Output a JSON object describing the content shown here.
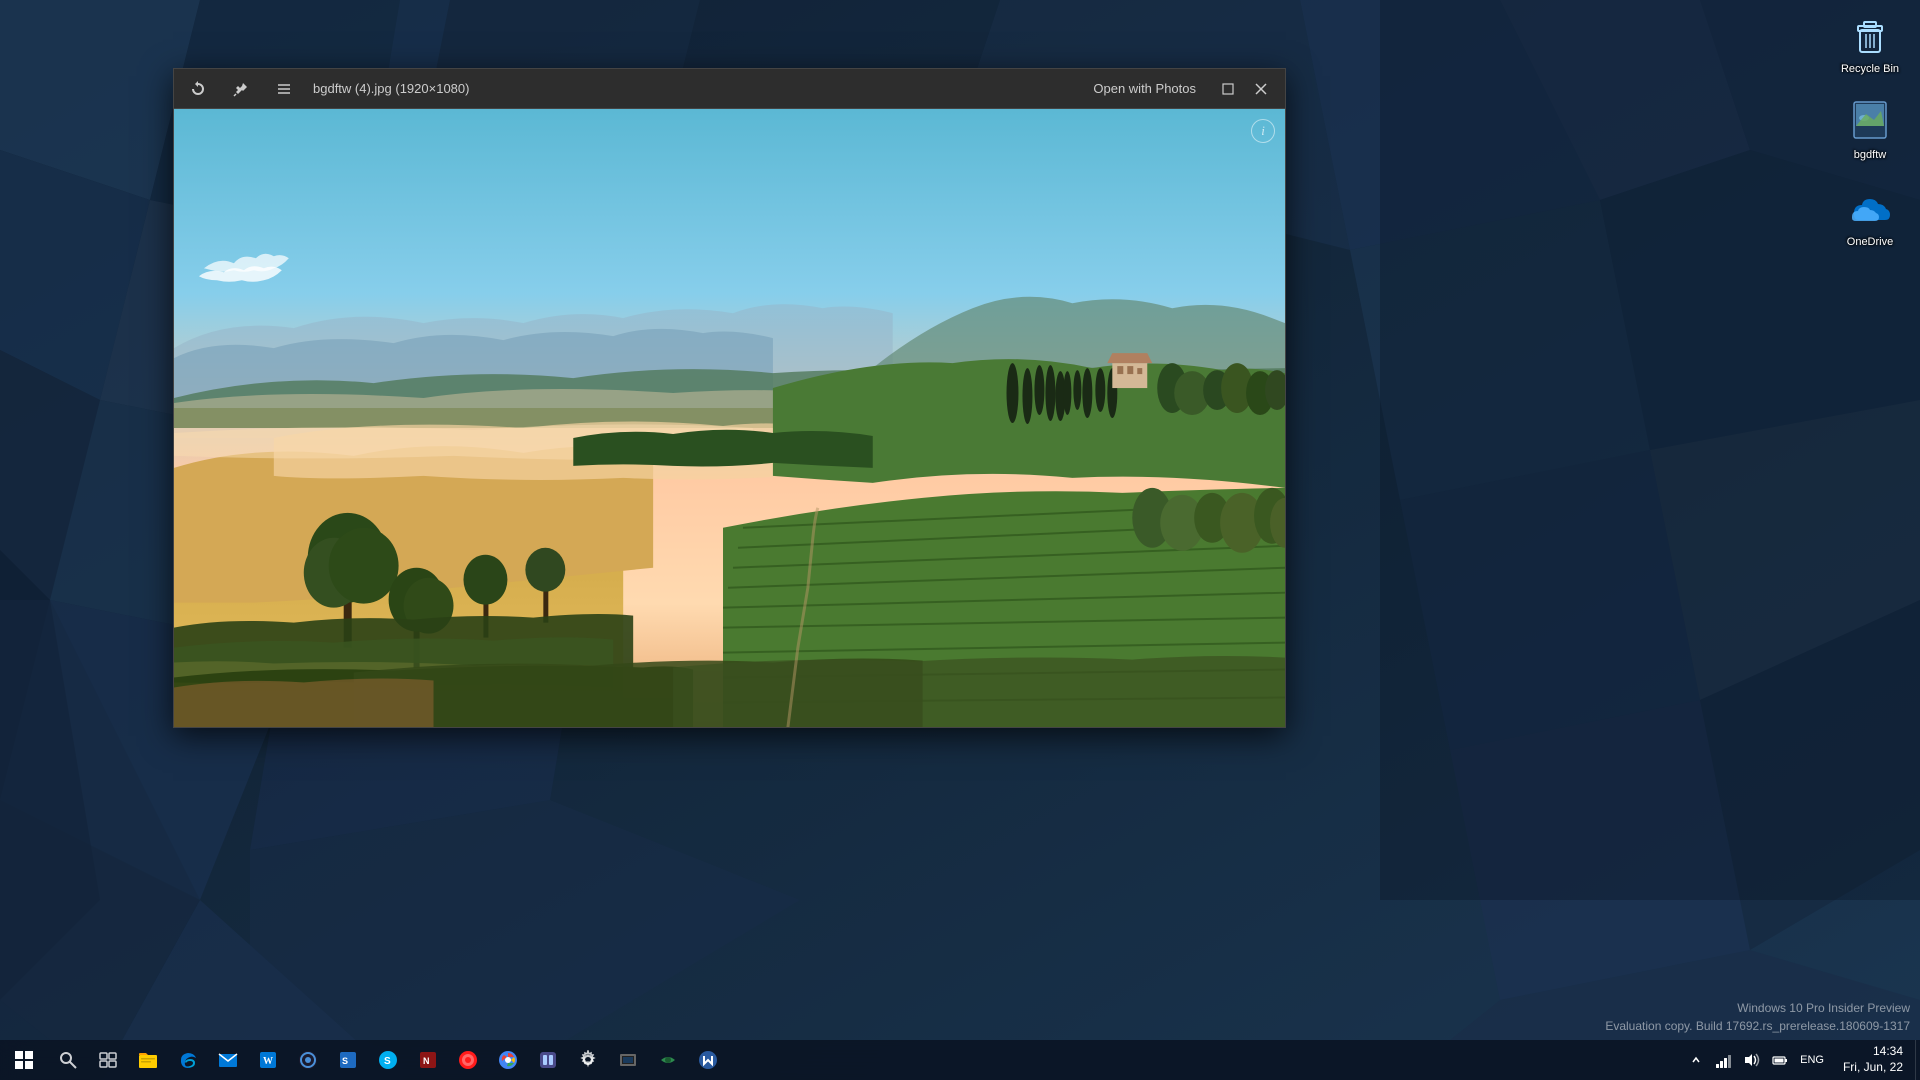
{
  "desktop": {
    "background_color": "#1e3048"
  },
  "desktop_icons": [
    {
      "id": "recycle-bin",
      "label": "Recycle Bin",
      "icon": "recycle-bin"
    },
    {
      "id": "bgdftw",
      "label": "bgdftw",
      "icon": "image-file"
    },
    {
      "id": "onedrive",
      "label": "OneDrive",
      "icon": "cloud"
    }
  ],
  "photo_viewer": {
    "title": "bgdftw (4).jpg (1920×1080)",
    "open_with_label": "Open with Photos",
    "toolbar": {
      "rotate_icon": "↑",
      "pin_icon": "📌",
      "menu_icon": "≡"
    },
    "info_icon": "i"
  },
  "taskbar": {
    "start_icon": "⊞",
    "search_icon": "🔍",
    "apps": [
      {
        "id": "start",
        "label": "Start",
        "icon": "⊞"
      },
      {
        "id": "search",
        "label": "Search",
        "icon": "⌕"
      },
      {
        "id": "taskview",
        "label": "Task View",
        "icon": "❑"
      },
      {
        "id": "explorer",
        "label": "File Explorer",
        "icon": "📁"
      },
      {
        "id": "edge",
        "label": "Microsoft Edge",
        "icon": "e"
      },
      {
        "id": "mail",
        "label": "Mail",
        "icon": "✉"
      },
      {
        "id": "folder",
        "label": "Folder",
        "icon": "📂"
      },
      {
        "id": "store",
        "label": "Store",
        "icon": "🛍"
      },
      {
        "id": "word",
        "label": "Word",
        "icon": "W"
      },
      {
        "id": "app1",
        "label": "App",
        "icon": "◎"
      },
      {
        "id": "app2",
        "label": "App2",
        "icon": "◈"
      },
      {
        "id": "skype",
        "label": "Skype",
        "icon": "S"
      },
      {
        "id": "app3",
        "label": "App3",
        "icon": "N"
      },
      {
        "id": "opera",
        "label": "Opera",
        "icon": "O"
      },
      {
        "id": "chrome",
        "label": "Chrome",
        "icon": "◉"
      },
      {
        "id": "app4",
        "label": "App4",
        "icon": "◇"
      },
      {
        "id": "settings",
        "label": "Settings",
        "icon": "⚙"
      },
      {
        "id": "app5",
        "label": "App5",
        "icon": "◻"
      },
      {
        "id": "app6",
        "label": "App6",
        "icon": "◈"
      },
      {
        "id": "app7",
        "label": "App7",
        "icon": "◎"
      }
    ],
    "systray": {
      "chevron": "^",
      "network": "📶",
      "volume": "🔊",
      "battery": "🔋",
      "lang": "ENG"
    },
    "clock": {
      "time": "14:34",
      "date": "Fri, Jun, 22"
    }
  },
  "watermark": {
    "line1": "Windows 10 Pro Insider Preview",
    "line2": "Evaluation copy. Build 17692.rs_prerelease.180609-1317"
  }
}
